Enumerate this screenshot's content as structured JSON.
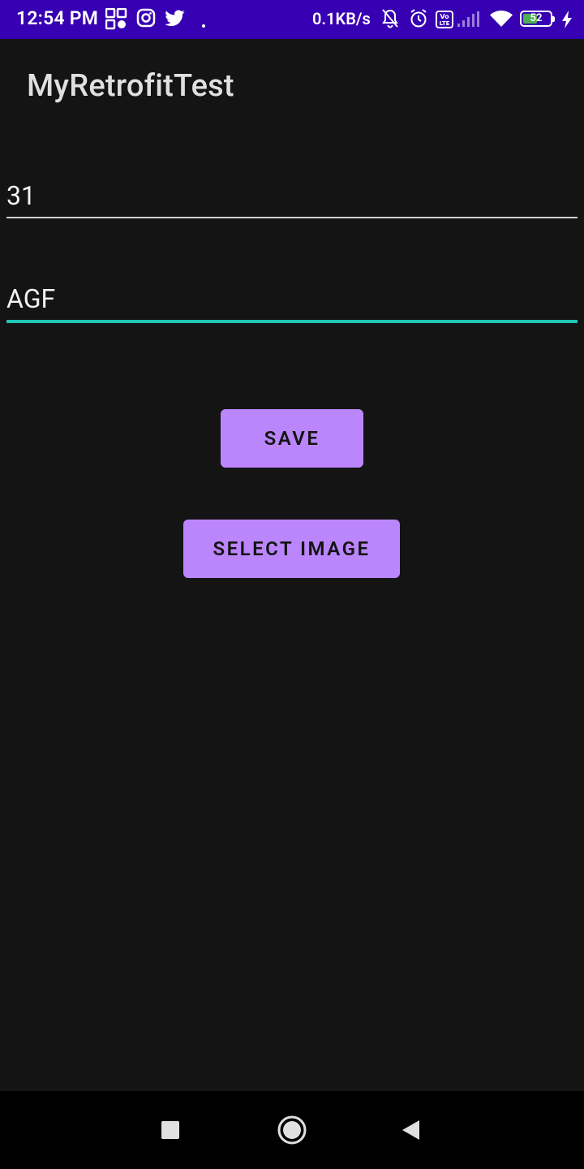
{
  "status_bar": {
    "time": "12:54 PM",
    "network_speed": "0.1KB/s",
    "battery_level": "52",
    "icons": [
      "app-grid-icon",
      "instagram-icon",
      "twitter-icon",
      "notification-dot-icon",
      "mute-icon",
      "alarm-icon",
      "volte-icon",
      "cell-signal-icon",
      "wifi-icon",
      "battery-icon",
      "charging-icon"
    ],
    "background_color": "#3700b3"
  },
  "app_bar": {
    "title": "MyRetrofitTest"
  },
  "form": {
    "field_1_value": "31",
    "field_2_value": "AGF",
    "focus_color": "#20c5b5"
  },
  "buttons": {
    "save_label": "SAVE",
    "select_image_label": "SELECT IMAGE",
    "color": "#bb86fc"
  },
  "nav_bar": {
    "icons": [
      "recents-square-icon",
      "home-circle-icon",
      "back-triangle-icon"
    ]
  }
}
